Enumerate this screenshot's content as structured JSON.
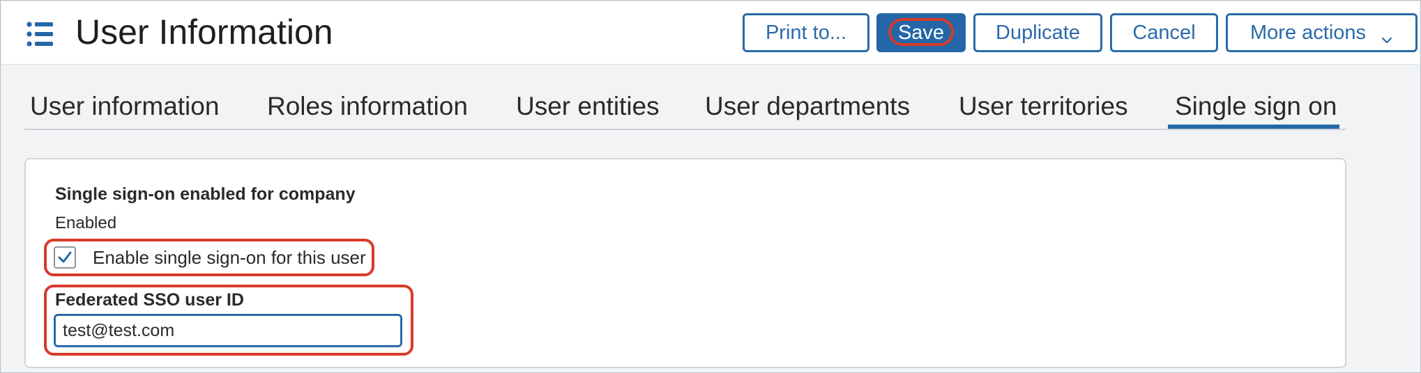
{
  "header": {
    "title": "User Information",
    "menu_icon": "list-menu-icon",
    "buttons": {
      "print": "Print to...",
      "save": "Save",
      "duplicate": "Duplicate",
      "cancel": "Cancel",
      "more_actions": "More actions"
    }
  },
  "tabs": [
    {
      "label": "User information",
      "active": false
    },
    {
      "label": "Roles information",
      "active": false
    },
    {
      "label": "User entities",
      "active": false
    },
    {
      "label": "User departments",
      "active": false
    },
    {
      "label": "User territories",
      "active": false
    },
    {
      "label": "Single sign on",
      "active": true
    }
  ],
  "sso": {
    "company_label": "Single sign-on enabled for company",
    "company_value": "Enabled",
    "enable_user_label": "Enable single sign-on for this user",
    "enable_user_checked": true,
    "federated_id_label": "Federated SSO user ID",
    "federated_id_value": "test@test.com"
  },
  "colors": {
    "accent": "#2467a8",
    "highlight": "#d83a2c",
    "background": "#f1f3f5"
  }
}
